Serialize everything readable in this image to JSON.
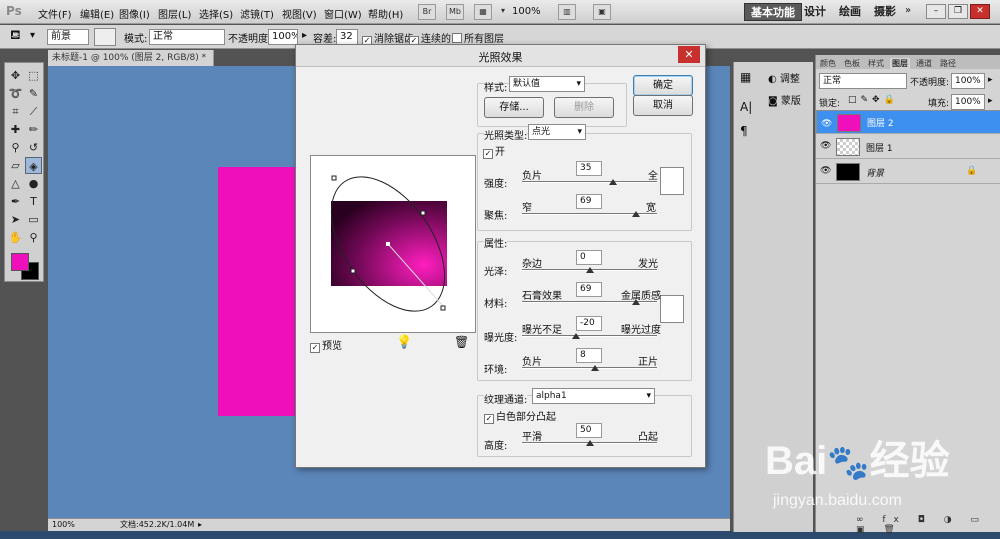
{
  "menubar": {
    "logo": "Ps",
    "items": [
      "文件(F)",
      "编辑(E)",
      "图像(I)",
      "图层(L)",
      "选择(S)",
      "滤镜(T)",
      "视图(V)",
      "窗口(W)",
      "帮助(H)"
    ],
    "icons": [
      "Br",
      "Mb"
    ],
    "zoom": "100%",
    "workspaces": [
      "基本功能",
      "设计",
      "绘画",
      "摄影"
    ]
  },
  "options": {
    "preset": "前景",
    "mode_label": "模式:",
    "mode": "正常",
    "opacity_label": "不透明度:",
    "opacity": "100%",
    "tolerance_label": "容差:",
    "tolerance": "32",
    "antialias": "消除锯齿",
    "contiguous": "连续的",
    "all_layers": "所有图层"
  },
  "document": {
    "tab": "未标题-1 @ 100% (图层 2, RGB/8) *",
    "zoom": "100%",
    "doc_info": "文档:452.2K/1.04M"
  },
  "dialog": {
    "title": "光照效果",
    "style_label": "样式:",
    "style_value": "默认值",
    "save_button": "存储...",
    "delete_button": "删除",
    "ok_button": "确定",
    "cancel_button": "取消",
    "light_type_label": "光照类型:",
    "light_type_value": "点光",
    "on_label": "开",
    "intensity_label": "强度:",
    "intensity_left": "负片",
    "intensity_right": "全",
    "intensity_value": "35",
    "focus_label": "聚焦:",
    "focus_left": "窄",
    "focus_right": "宽",
    "focus_value": "69",
    "properties_label": "属性:",
    "gloss_label": "光泽:",
    "gloss_left": "杂边",
    "gloss_right": "发光",
    "gloss_value": "0",
    "material_label": "材料:",
    "material_left": "石膏效果",
    "material_right": "金属质感",
    "material_value": "69",
    "exposure_label": "曝光度:",
    "exposure_left": "曝光不足",
    "exposure_right": "曝光过度",
    "exposure_value": "-20",
    "ambience_label": "环境:",
    "ambience_left": "负片",
    "ambience_right": "正片",
    "ambience_value": "8",
    "texture_label": "纹理通道:",
    "texture_value": "alpha1",
    "white_high_label": "白色部分凸起",
    "height_label": "高度:",
    "height_left": "平滑",
    "height_right": "凸起",
    "height_value": "50",
    "preview_label": "预览"
  },
  "dock": {
    "adjust": "调整",
    "mask": "蒙版"
  },
  "layers": {
    "tabs": [
      "颜色",
      "色板",
      "样式",
      "图层",
      "通道",
      "路径"
    ],
    "blend": "正常",
    "opacity_label": "不透明度:",
    "opacity": "100%",
    "lock_label": "锁定:",
    "fill_label": "填充:",
    "fill": "100%",
    "rows": [
      {
        "name": "图层 2",
        "selected": true
      },
      {
        "name": "图层 1",
        "selected": false
      },
      {
        "name": "背景",
        "selected": false
      }
    ]
  },
  "watermark": {
    "brand": "Bai",
    "brand2": "经验",
    "url": "jingyan.baidu.com"
  },
  "colors": {
    "foreground": "#f010bb",
    "canvas": "#5b86b9",
    "selection": "#3d8ff0"
  }
}
